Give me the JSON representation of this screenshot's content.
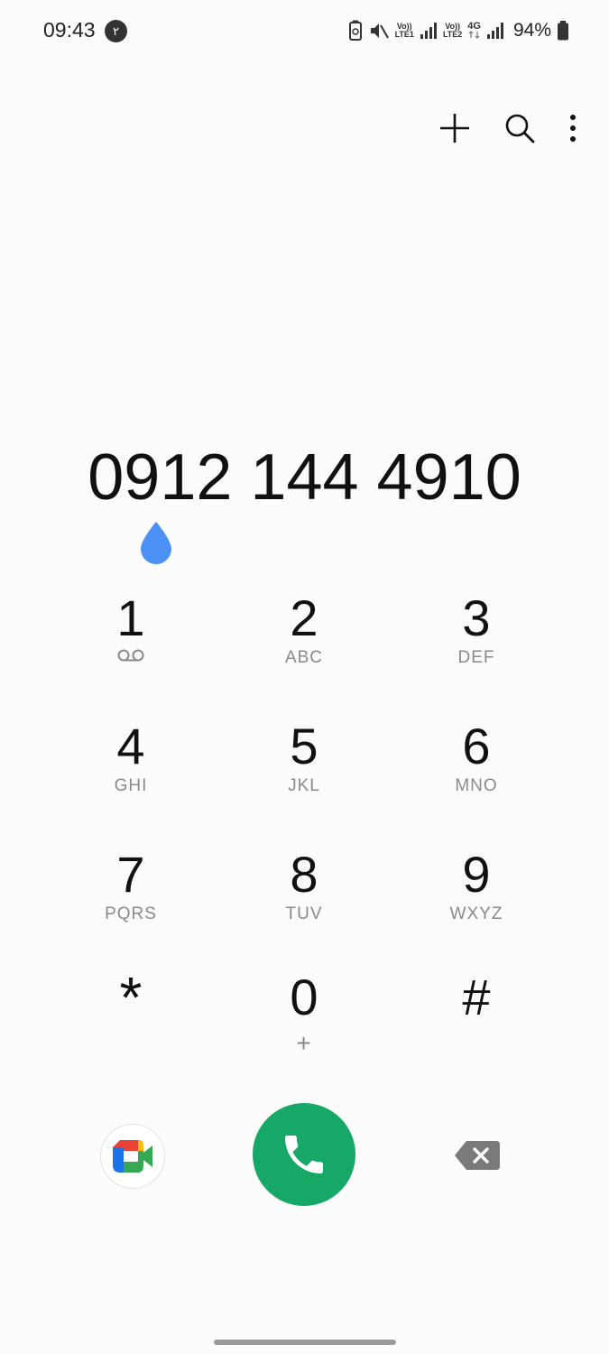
{
  "status_bar": {
    "time": "09:43",
    "notification_badge": "۲",
    "volte1_top": "Vo))",
    "volte1_bottom": "LTE1",
    "volte2_top": "Vo))",
    "volte2_bottom": "LTE2",
    "network": "4G",
    "battery_percent": "94%",
    "icons": [
      "battery-saver-icon",
      "mute-icon",
      "signal-icon",
      "signal-icon",
      "battery-icon"
    ]
  },
  "toolbar": {
    "icons": [
      "add-icon",
      "search-icon",
      "more-vertical-icon"
    ]
  },
  "dialer": {
    "number": "0912 144 4910",
    "keys": [
      {
        "digit": "1",
        "letters": ""
      },
      {
        "digit": "2",
        "letters": "ABC"
      },
      {
        "digit": "3",
        "letters": "DEF"
      },
      {
        "digit": "4",
        "letters": "GHI"
      },
      {
        "digit": "5",
        "letters": "JKL"
      },
      {
        "digit": "6",
        "letters": "MNO"
      },
      {
        "digit": "7",
        "letters": "PQRS"
      },
      {
        "digit": "8",
        "letters": "TUV"
      },
      {
        "digit": "9",
        "letters": "WXYZ"
      },
      {
        "digit": "*",
        "letters": ""
      },
      {
        "digit": "0",
        "letters": "+"
      },
      {
        "digit": "#",
        "letters": ""
      }
    ]
  },
  "colors": {
    "background": "#fbfbfb",
    "call_button": "#16a866",
    "cursor_handle": "#4a90f5",
    "backspace": "#7a7a7a"
  }
}
